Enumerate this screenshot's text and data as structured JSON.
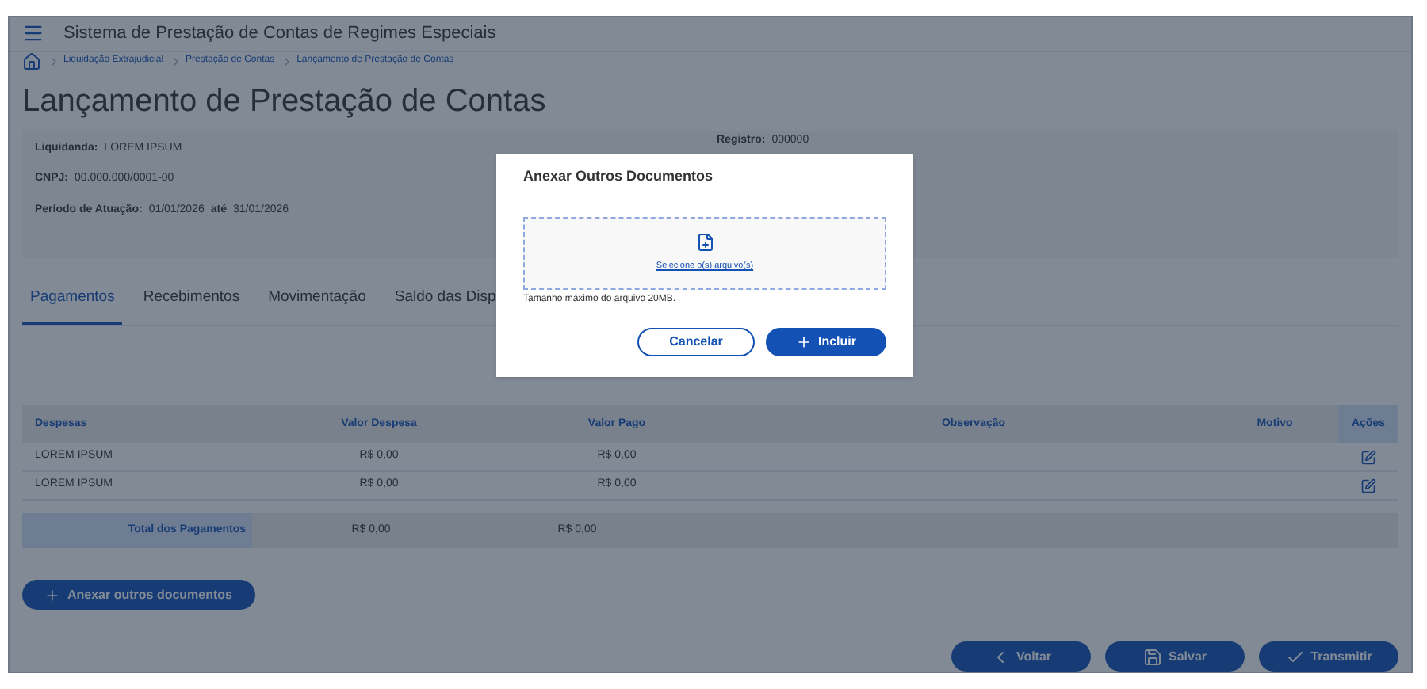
{
  "header": {
    "title": "Sistema de Prestação de Contas de Regimes Especiais"
  },
  "breadcrumb": [
    "Liquidação Extrajudicial",
    "Prestação de Contas",
    "Lançamento de Prestação de Contas"
  ],
  "page_title": "Lançamento de Prestação de Contas",
  "info": [
    {
      "label": "Liquidanda:",
      "value": "LOREM IPSUM"
    },
    {
      "label": "CNPJ:",
      "value": "00.000.000/0001-00"
    },
    {
      "label": "Período de Atuação:",
      "value": "01/01/2026",
      "sep": "até",
      "value2": "31/01/2026"
    }
  ],
  "registro": {
    "label": "Registro:",
    "value": "000000"
  },
  "tabs": [
    {
      "label": "Pagamentos",
      "selected": true
    },
    {
      "label": "Recebimentos",
      "selected": false
    },
    {
      "label": "Movimentação",
      "selected": false
    },
    {
      "label": "Saldo das Disp",
      "selected": false
    }
  ],
  "table": {
    "columns": [
      "Despesas",
      "Valor Despesa",
      "Valor Pago",
      "Observação",
      "Motivo",
      "Ações"
    ],
    "rows": [
      [
        "LOREM IPSUM",
        "R$ 0,00",
        "R$ 0,00"
      ],
      [
        "LOREM IPSUM",
        "R$ 0,00",
        "R$ 0,00"
      ]
    ],
    "total": [
      "Total dos Pagamentos",
      "R$ 0,00",
      "R$ 0,00"
    ]
  },
  "attach_button": "Anexar outros documentos",
  "footer_buttons": [
    {
      "label": "Voltar",
      "kind": "back"
    },
    {
      "label": "Salvar",
      "kind": "save"
    },
    {
      "label": "Transmitir",
      "kind": "submit"
    }
  ],
  "modal": {
    "title": "Anexar Outros Documentos",
    "upload_link": "Selecione o(s) arquivo(s)",
    "hint": "Tamanho máximo do arquivo 20MB.",
    "cancel": "Cancelar",
    "confirm": "Incluir"
  }
}
